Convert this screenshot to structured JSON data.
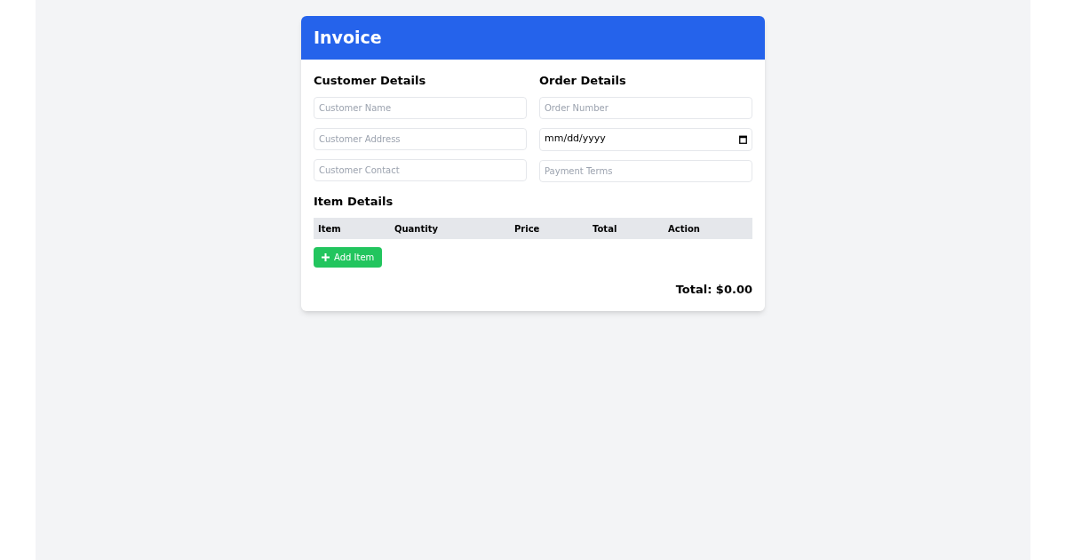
{
  "title": "Invoice",
  "customer": {
    "heading": "Customer Details",
    "fields": [
      {
        "placeholder": "Customer Name"
      },
      {
        "placeholder": "Customer Address"
      },
      {
        "placeholder": "Customer Contact"
      }
    ]
  },
  "order": {
    "heading": "Order Details",
    "fields": [
      {
        "kind": "text",
        "placeholder": "Order Number"
      },
      {
        "kind": "date",
        "value": "mm/dd/yyyy"
      },
      {
        "kind": "text",
        "placeholder": "Payment Terms"
      }
    ]
  },
  "items": {
    "heading": "Item Details",
    "columns": [
      "Item",
      "Quantity",
      "Price",
      "Total",
      "Action"
    ]
  },
  "add_button": "Add Item",
  "total": "Total: $0.00"
}
